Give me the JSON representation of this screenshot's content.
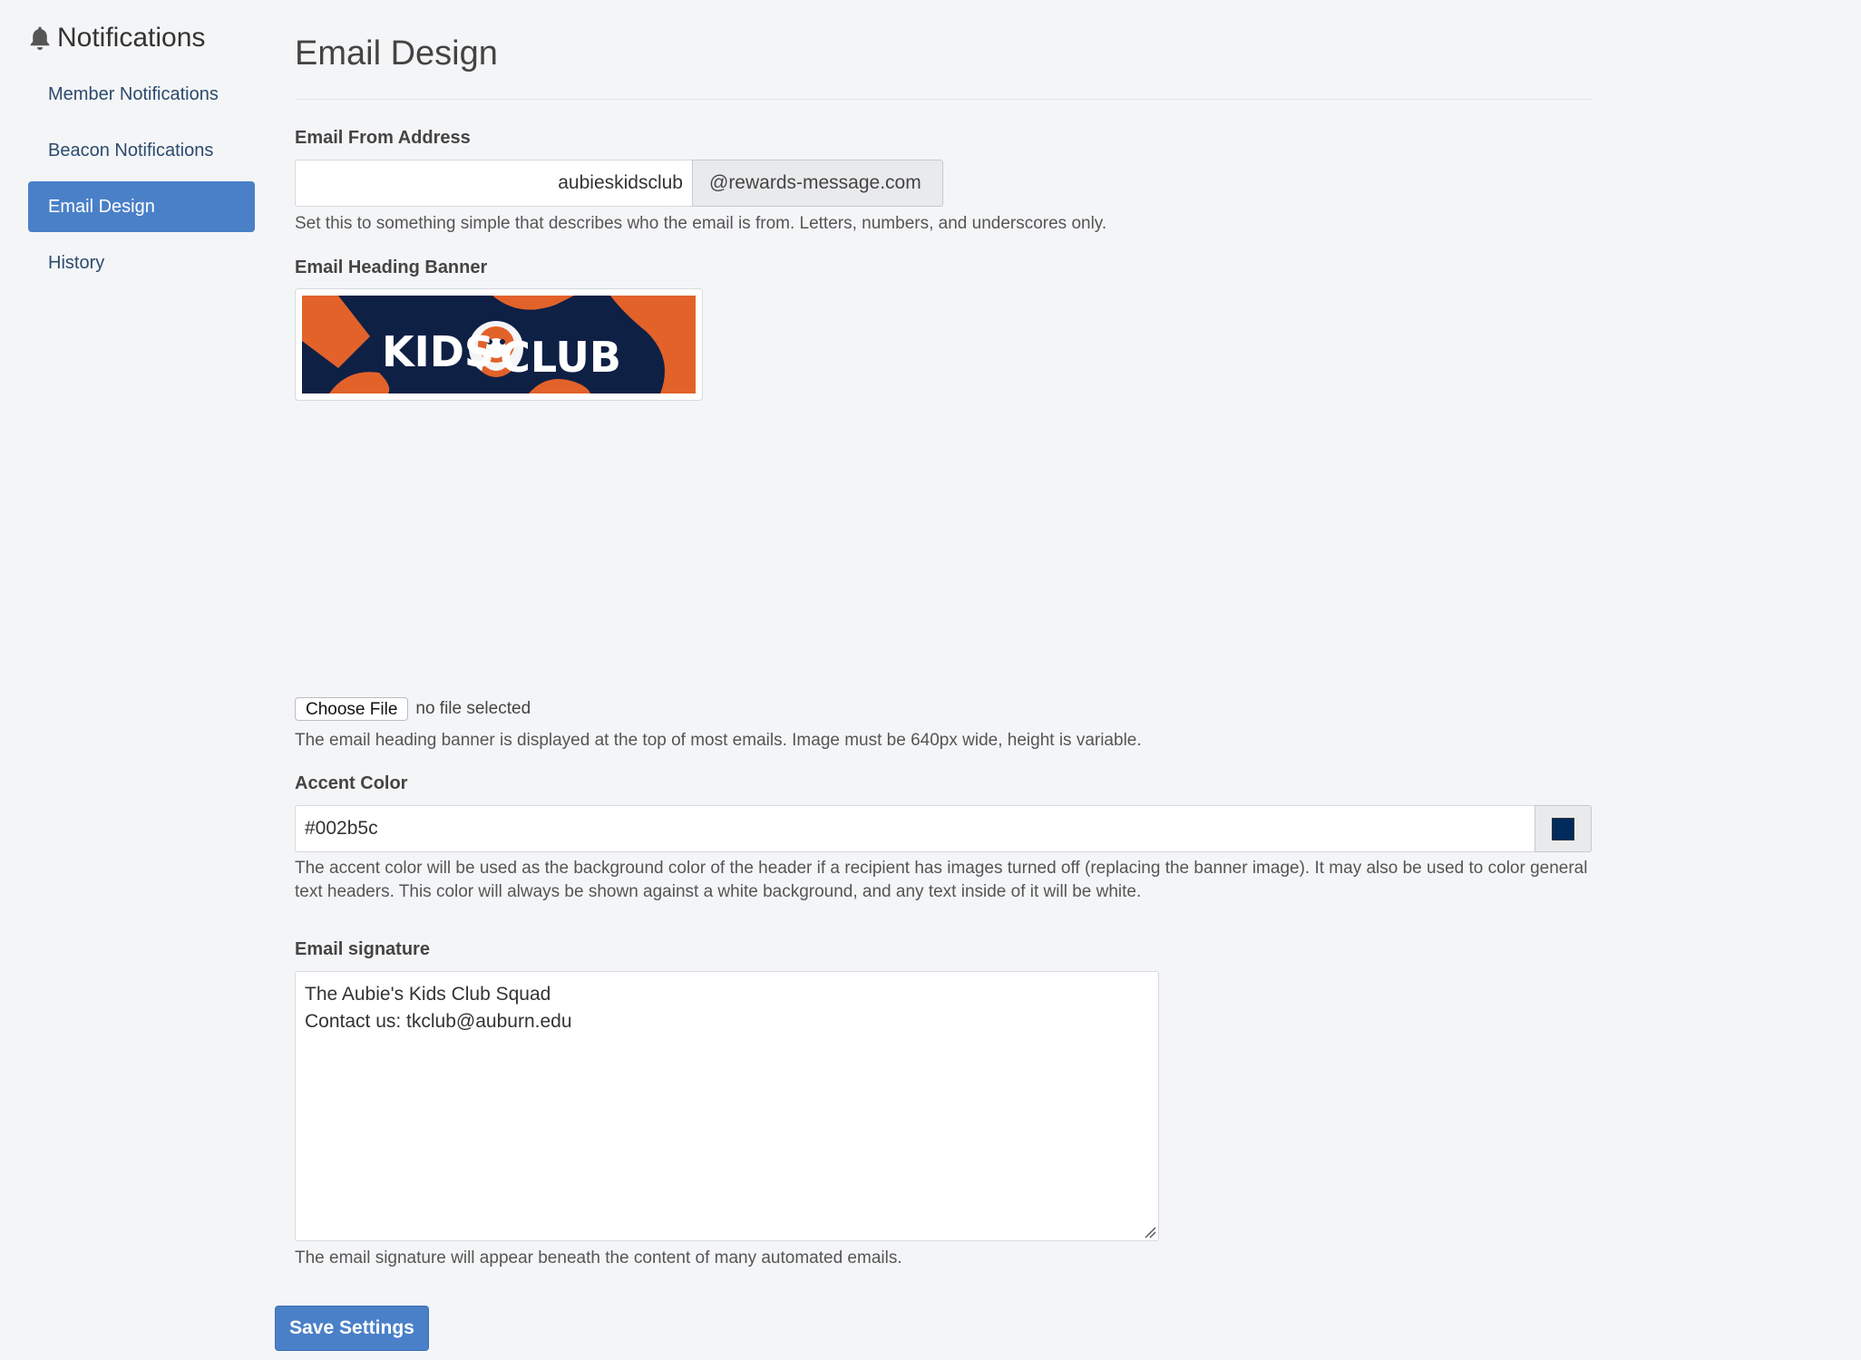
{
  "sidebar": {
    "title": "Notifications",
    "items": [
      {
        "label": "Member Notifications",
        "active": false
      },
      {
        "label": "Beacon Notifications",
        "active": false
      },
      {
        "label": "Email Design",
        "active": true
      },
      {
        "label": "History",
        "active": false
      }
    ]
  },
  "main": {
    "title": "Email Design",
    "from_address": {
      "label": "Email From Address",
      "value": "aubieskidsclub",
      "domain": "@rewards-message.com",
      "help": "Set this to something simple that describes who the email is from. Letters, numbers, and underscores only."
    },
    "banner": {
      "label": "Email Heading Banner",
      "image_text_left": "KIDS",
      "image_text_right": "CLUB",
      "choose_file_label": "Choose File",
      "file_status": "no file selected",
      "help": "The email heading banner is displayed at the top of most emails. Image must be 640px wide, height is variable."
    },
    "accent": {
      "label": "Accent Color",
      "value": "#002b5c",
      "swatch_color": "#002b5c",
      "help": "The accent color will be used as the background color of the header if a recipient has images turned off (replacing the banner image). It may also be used to color general text headers. This color will always be shown against a white background, and any text inside of it will be white."
    },
    "signature": {
      "label": "Email signature",
      "line1": "The Aubie's Kids Club Squad",
      "line2": "Contact us: tkclub@auburn.edu",
      "help": "The email signature will appear beneath the content of many automated emails."
    },
    "save_label": "Save Settings"
  },
  "colors": {
    "primary": "#4a80c8",
    "banner_navy": "#0f2045",
    "banner_orange": "#e2622a"
  }
}
